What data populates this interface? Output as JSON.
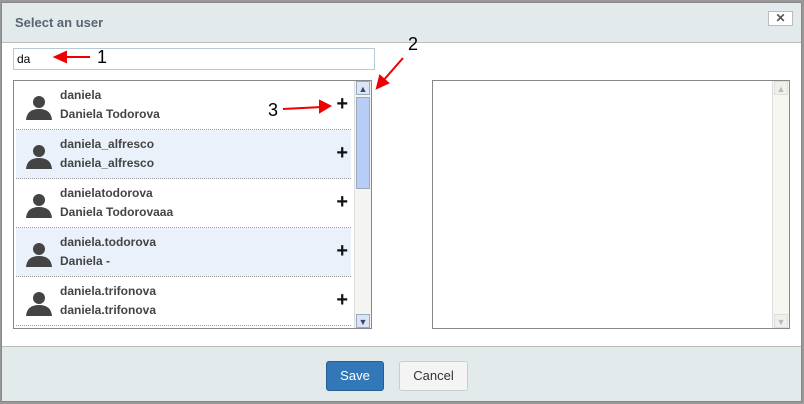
{
  "dialog": {
    "title": "Select an user",
    "close": "✕"
  },
  "search": {
    "value": "da"
  },
  "users": [
    {
      "username": "daniela",
      "fullname": "Daniela Todorova"
    },
    {
      "username": "daniela_alfresco",
      "fullname": "daniela_alfresco"
    },
    {
      "username": "danielatodorova",
      "fullname": "Daniela Todorovaaa"
    },
    {
      "username": "daniela.todorova",
      "fullname": "Daniela -"
    },
    {
      "username": "daniela.trifonova",
      "fullname": "daniela.trifonova"
    }
  ],
  "add_label": "+",
  "footer": {
    "save": "Save",
    "cancel": "Cancel"
  },
  "annotations": [
    "1",
    "2",
    "3"
  ]
}
